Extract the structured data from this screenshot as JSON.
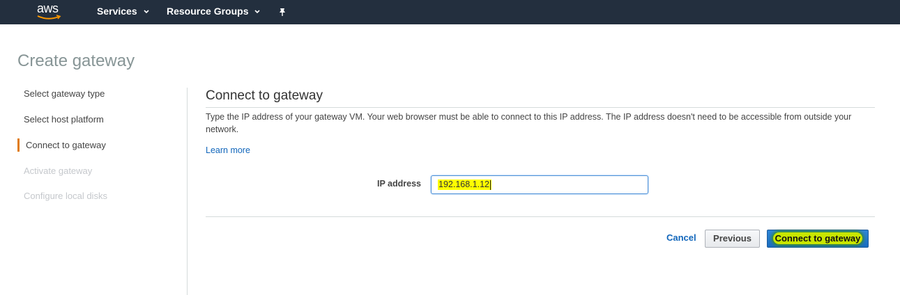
{
  "nav": {
    "logo_text": "aws",
    "services_label": "Services",
    "resource_groups_label": "Resource Groups",
    "pin_icon": "pin-icon"
  },
  "page": {
    "title": "Create gateway"
  },
  "steps": [
    {
      "label": "Select gateway type",
      "state": "done"
    },
    {
      "label": "Select host platform",
      "state": "done"
    },
    {
      "label": "Connect to gateway",
      "state": "active"
    },
    {
      "label": "Activate gateway",
      "state": "disabled"
    },
    {
      "label": "Configure local disks",
      "state": "disabled"
    }
  ],
  "main": {
    "section_title": "Connect to gateway",
    "description": "Type the IP address of your gateway VM. Your web browser must be able to connect to this IP address. The IP address doesn't need to be accessible from outside your network.",
    "learn_more": "Learn more",
    "ip_label": "IP address",
    "ip_value": "192.168.1.12"
  },
  "actions": {
    "cancel": "Cancel",
    "previous": "Previous",
    "connect": "Connect to gateway"
  },
  "colors": {
    "nav_bg": "#232f3e",
    "active_step_bar": "#e07b12",
    "link": "#1166bb",
    "primary_button": "#1a6cbf",
    "highlight": "#ffff00"
  }
}
